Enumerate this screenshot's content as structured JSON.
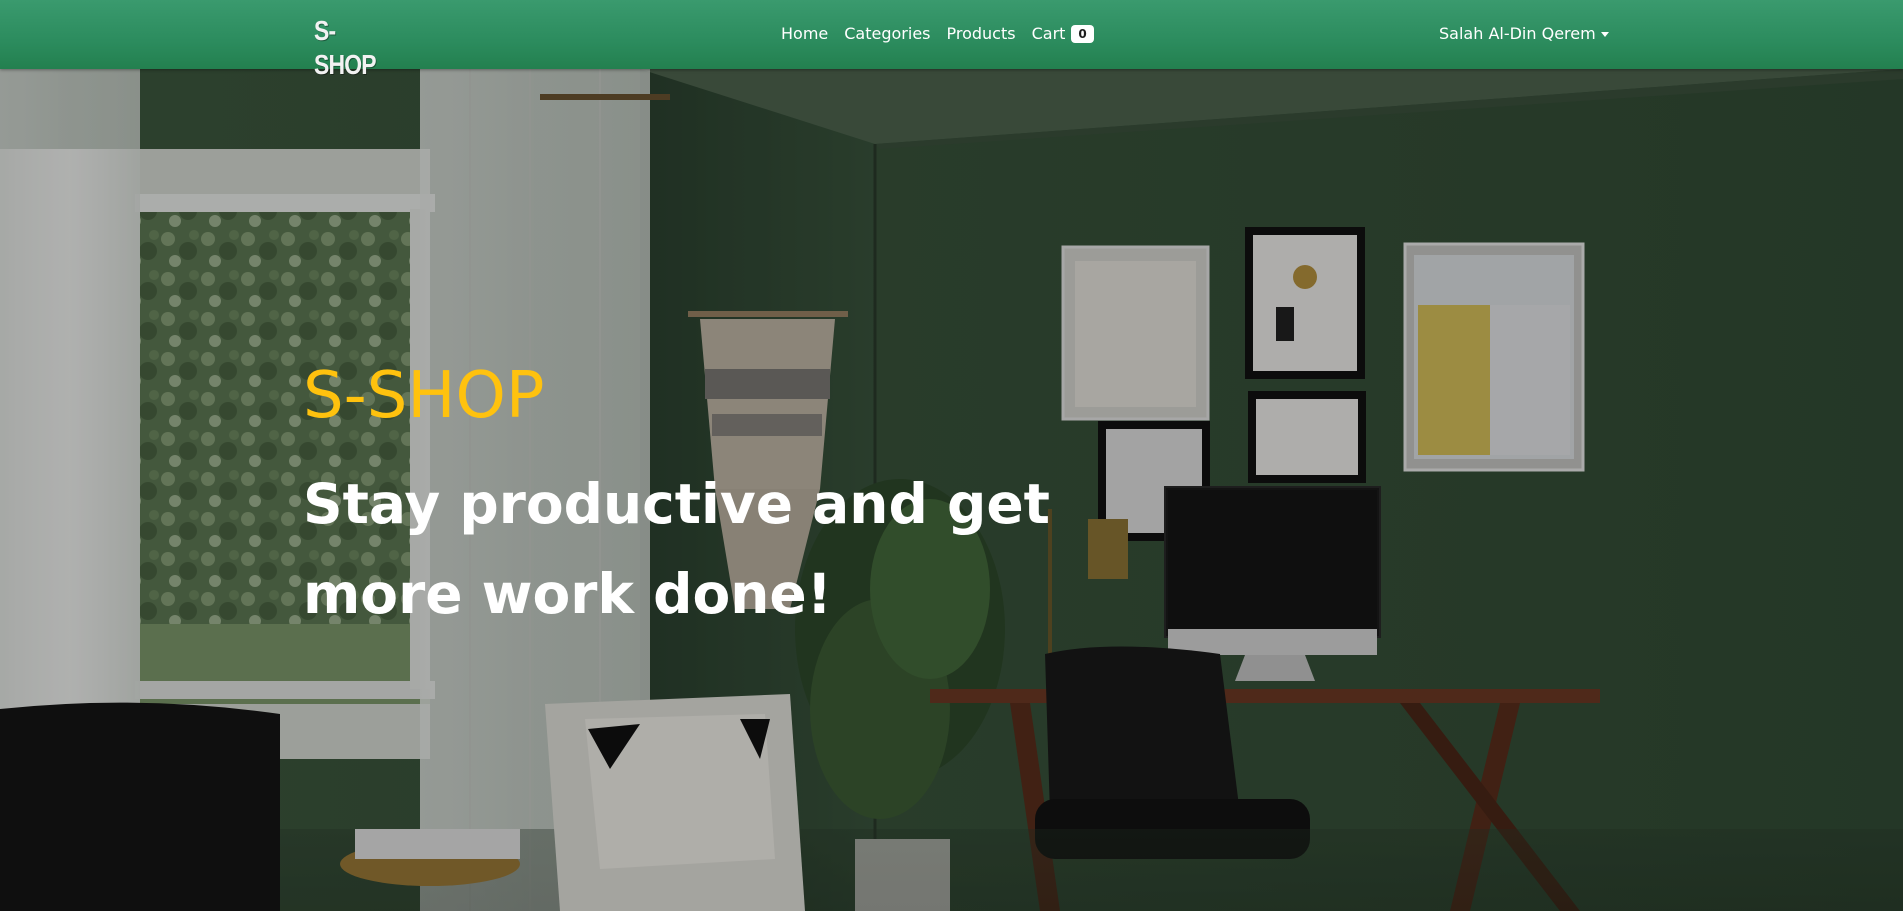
{
  "navbar": {
    "logo_text": "S-SHOP",
    "links": [
      {
        "label": "Home"
      },
      {
        "label": "Categories"
      },
      {
        "label": "Products"
      },
      {
        "label": "Cart"
      }
    ],
    "cart_count": "0",
    "user_name": "Salah Al-Din Qerem"
  },
  "hero": {
    "brand": "S-SHOP",
    "tagline": "Stay productive and get more work done!"
  },
  "colors": {
    "navbar": "#2c8c5e",
    "brand_accent": "#ffc20e"
  },
  "icons": {
    "user_dropdown": "caret-down-icon"
  }
}
